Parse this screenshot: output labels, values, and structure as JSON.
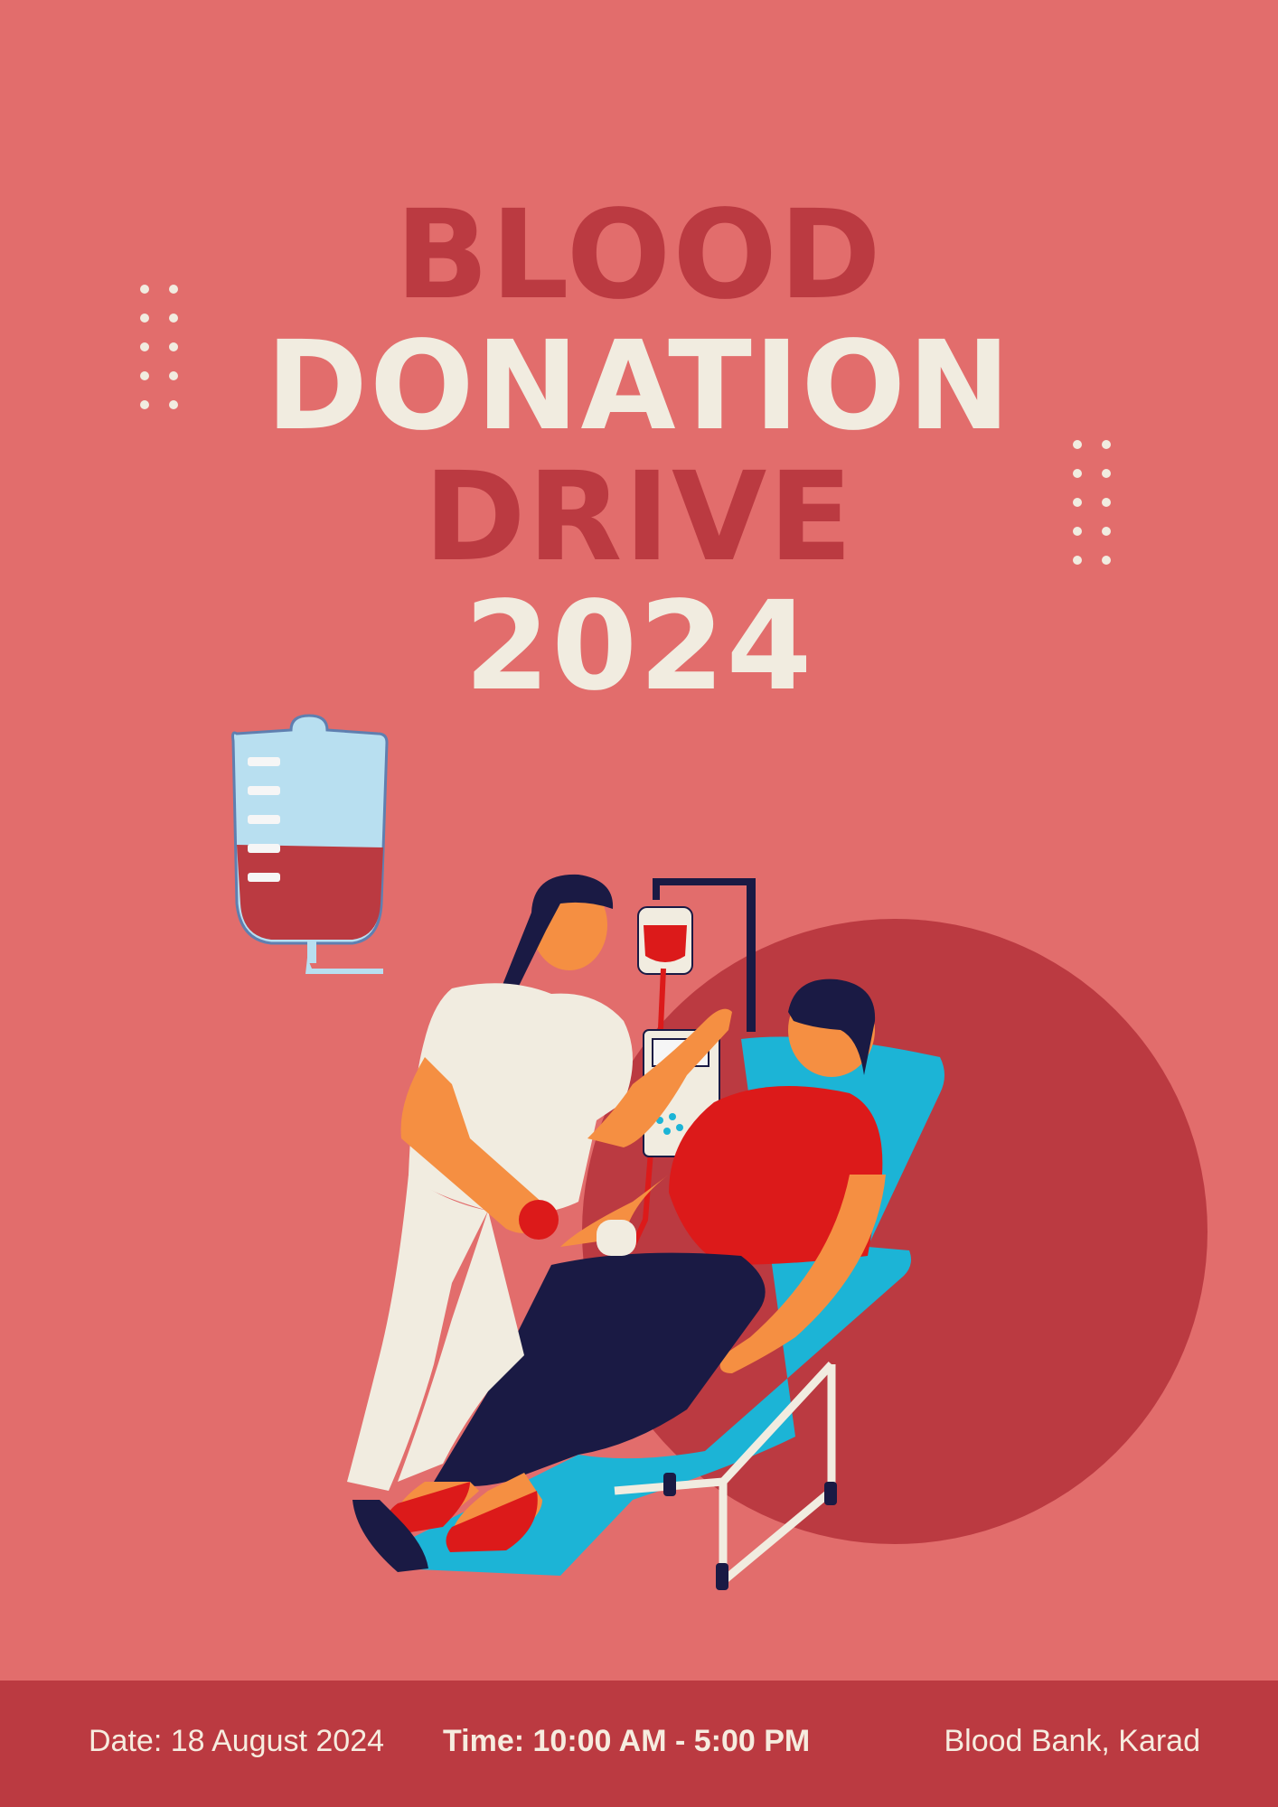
{
  "title": {
    "line1": "BLOOD",
    "line2": "DONATION",
    "line3": "DRIVE",
    "line4": "2024"
  },
  "footer": {
    "date": "Date: 18 August 2024",
    "time": "Time: 10:00 AM - 5:00 PM",
    "location": "Blood Bank, Karad"
  },
  "colors": {
    "background": "#e26d6c",
    "accent_dark_red": "#bb3a41",
    "cream": "#f1ece0",
    "blood_red": "#dc1a1a",
    "navy": "#1a1a44",
    "teal": "#1cb4d6",
    "light_blue": "#b8dff0",
    "skin": "#f58f42"
  },
  "icons": [
    "blood-bag-icon",
    "dots-grid-decoration"
  ]
}
